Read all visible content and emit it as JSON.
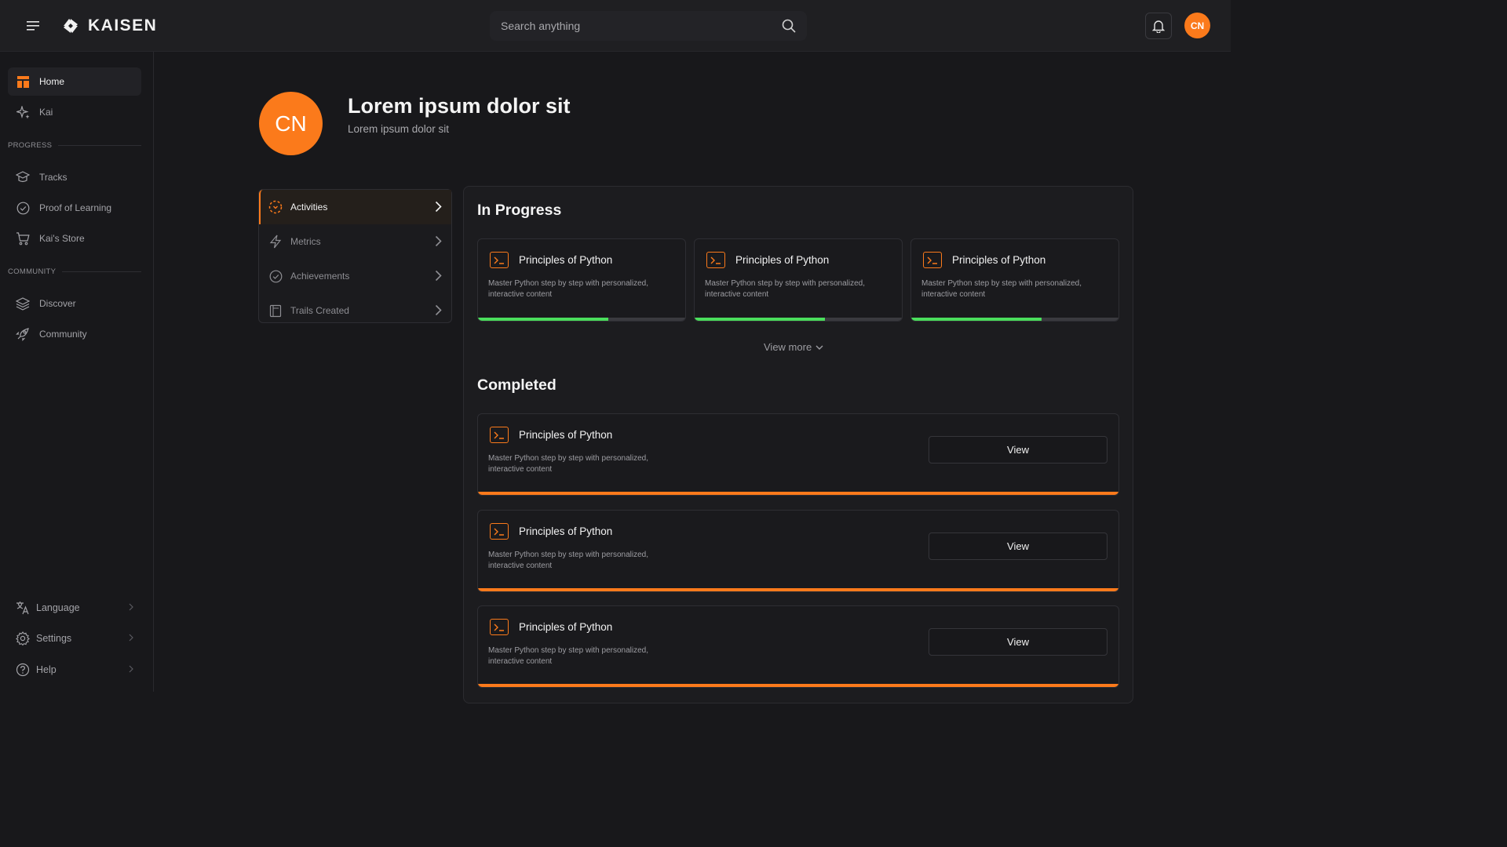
{
  "header": {
    "brand": "KAISEN",
    "search_placeholder": "Search anything",
    "user_initials": "CN"
  },
  "sidebar": {
    "items": [
      {
        "label": "Home",
        "icon": "home-icon"
      },
      {
        "label": "Kai",
        "icon": "sparkle-icon"
      }
    ],
    "progress_section": "PROGRESS",
    "progress_items": [
      {
        "label": "Tracks",
        "icon": "graduation-cap-icon"
      },
      {
        "label": "Proof of Learning",
        "icon": "check-circle-icon"
      },
      {
        "label": "Kai's Store",
        "icon": "cart-icon"
      }
    ],
    "community_section": "COMMUNITY",
    "community_items": [
      {
        "label": "Discover",
        "icon": "layers-icon"
      },
      {
        "label": "Community",
        "icon": "rocket-icon"
      }
    ],
    "bottom_items": [
      {
        "label": "Language",
        "icon": "translate-icon"
      },
      {
        "label": "Settings",
        "icon": "gear-icon"
      },
      {
        "label": "Help",
        "icon": "help-icon"
      }
    ]
  },
  "profile": {
    "initials": "CN",
    "name": "Lorem ipsum dolor sit",
    "subtitle": "Lorem ipsum dolor sit"
  },
  "side_menu": {
    "items": [
      {
        "label": "Activities",
        "icon": "activity-icon"
      },
      {
        "label": "Metrics",
        "icon": "lightning-icon"
      },
      {
        "label": "Achievements",
        "icon": "check-circle-icon"
      },
      {
        "label": "Trails Created",
        "icon": "book-icon"
      }
    ]
  },
  "in_progress": {
    "title": "In Progress",
    "cards": [
      {
        "title": "Principles of Python",
        "desc": "Master Python step by step with personalized, interactive content",
        "progress": 0.63
      },
      {
        "title": "Principles of Python",
        "desc": "Master Python step by step with personalized, interactive content",
        "progress": 0.63
      },
      {
        "title": "Principles of Python",
        "desc": "Master Python step by step with personalized, interactive content",
        "progress": 0.63
      }
    ],
    "view_more": "View more"
  },
  "completed": {
    "title": "Completed",
    "cards": [
      {
        "title": "Principles of Python",
        "desc": "Master Python step by step with personalized, interactive content",
        "button": "View"
      },
      {
        "title": "Principles of Python",
        "desc": "Master Python step by step with personalized, interactive content",
        "button": "View"
      },
      {
        "title": "Principles of Python",
        "desc": "Master Python step by step with personalized, interactive content",
        "button": "View"
      }
    ]
  },
  "colors": {
    "accent": "#fb7a1b",
    "progress": "#4ade5c",
    "background": "#18181b"
  }
}
